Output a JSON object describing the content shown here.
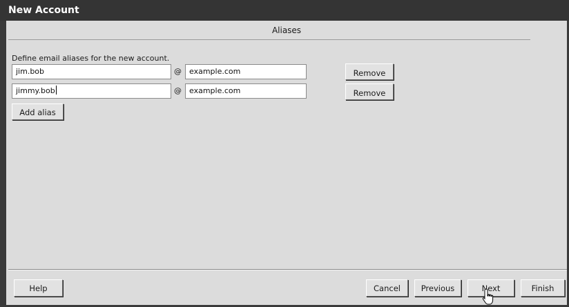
{
  "window": {
    "title": "New Account"
  },
  "section": {
    "title": "Aliases"
  },
  "instructions": "Define email aliases for the new account.",
  "aliases": [
    {
      "user": "jim.bob",
      "at": "@",
      "domain": "example.com",
      "remove_label": "Remove"
    },
    {
      "user": "jimmy.bob",
      "at": "@",
      "domain": "example.com",
      "remove_label": "Remove"
    }
  ],
  "add_alias_label": "Add alias",
  "footer": {
    "help_label": "Help",
    "cancel_label": "Cancel",
    "previous_label": "Previous",
    "next_label": "Next",
    "finish_label": "Finish"
  },
  "cursor": {
    "icon": "hand-pointer-icon"
  }
}
